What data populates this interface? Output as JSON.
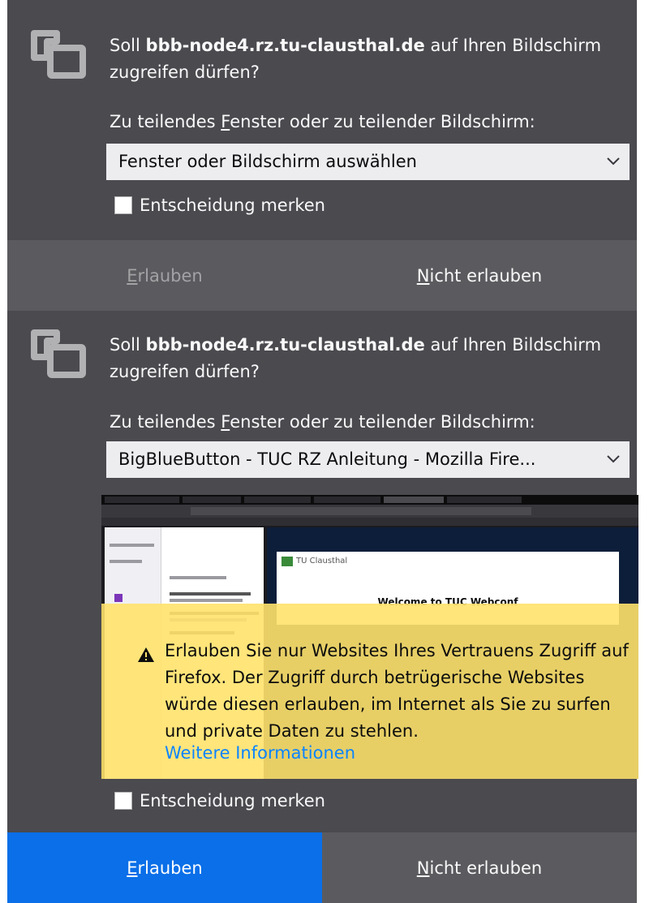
{
  "dialogs": [
    {
      "prompt_prefix": "Soll",
      "host": "bbb-node4.rz.tu-clausthal.de",
      "prompt_suffix": "auf Ihren Bildschirm zugreifen dürfen?",
      "select_label_before": "Zu teilendes ",
      "select_label_access": "F",
      "select_label_after": "enster oder zu teilender Bildschirm:",
      "select_value": "Fenster oder Bildschirm auswählen",
      "remember_label": "Entscheidung merken",
      "allow_access": "E",
      "allow_rest": "rlauben",
      "deny_access": "N",
      "deny_rest": "icht erlauben"
    },
    {
      "prompt_prefix": "Soll",
      "host": "bbb-node4.rz.tu-clausthal.de",
      "prompt_suffix": "auf Ihren Bildschirm zugreifen dürfen?",
      "select_label_before": "Zu teilendes ",
      "select_label_access": "F",
      "select_label_after": "enster oder zu teilender Bildschirm:",
      "select_value": "BigBlueButton - TUC RZ Anleitung - Mozilla Fire...",
      "preview": {
        "card_brand": "TU Clausthal",
        "card_title": "Welcome to TUC Webconf"
      },
      "warning": {
        "text": "Erlauben Sie nur Websites Ihres Vertrauens Zugriff auf Firefox. Der Zugriff durch betrügerische Websites würde diesen erlauben, im Internet als Sie zu surfen und private Daten zu stehlen.",
        "link": "Weitere Informationen"
      },
      "remember_label": "Entscheidung merken",
      "allow_access": "E",
      "allow_rest": "rlauben",
      "deny_access": "N",
      "deny_rest": "icht erlauben"
    }
  ],
  "colors": {
    "panel_bg": "#4a4a4f",
    "action_bar_bg": "#5b5b5f",
    "primary_blue": "#0a84ff",
    "warning_yellow": "#ffe26b"
  },
  "icons": {
    "share": "screen-share-icon",
    "dropdown": "chevron-down-icon",
    "warning": "warning-triangle-icon"
  }
}
